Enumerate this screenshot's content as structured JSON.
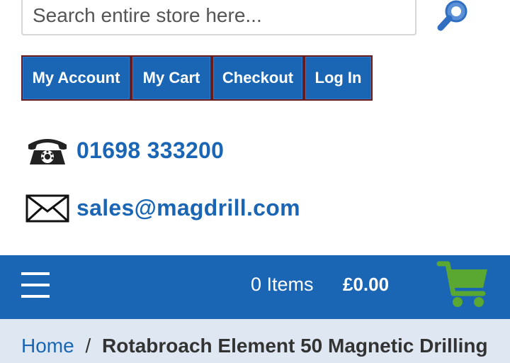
{
  "search": {
    "placeholder": "Search entire store here..."
  },
  "nav": [
    {
      "label": "My Account"
    },
    {
      "label": "My Cart"
    },
    {
      "label": "Checkout"
    },
    {
      "label": "Log In"
    }
  ],
  "contact": {
    "phone": "01698 333200",
    "email": "sales@magdrill.com",
    "phone_icon": "telephone-icon",
    "email_icon": "envelope-icon"
  },
  "cart_bar": {
    "items": "0 Items",
    "total": "£0.00",
    "cart_icon": "shopping-cart-icon",
    "menu_icon": "hamburger-menu-icon"
  },
  "breadcrumb": {
    "home": "Home",
    "separator": "/",
    "current": "Rotabroach Element 50 Magnetic Drilling"
  },
  "colors": {
    "brand_blue": "#1a66b5",
    "cart_green": "#5aa832",
    "breadcrumb_bg": "#dfe8f2"
  }
}
